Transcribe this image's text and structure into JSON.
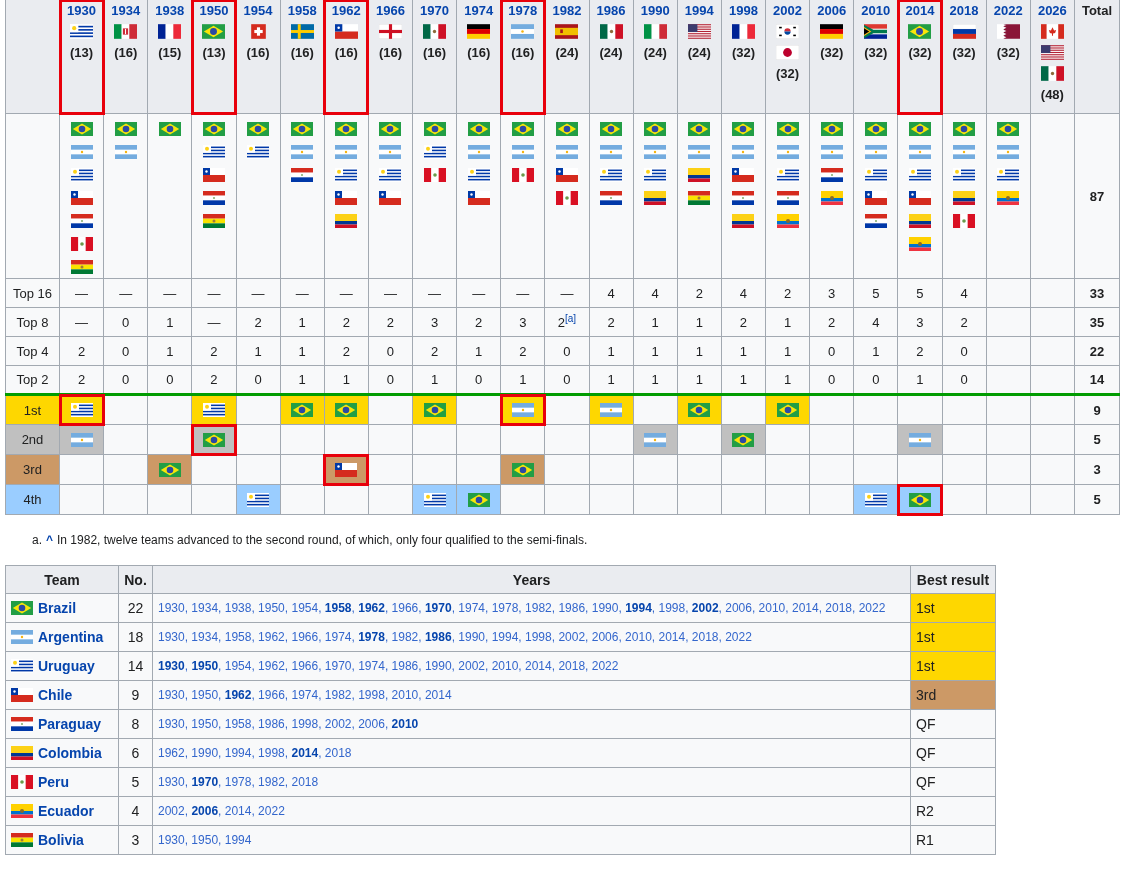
{
  "years": [
    {
      "year": "1930",
      "hosts": [
        {
          "kind": "URU"
        }
      ],
      "teams": "(13)",
      "highlighted": true,
      "qualified": [
        {
          "kind": "BRA"
        },
        {
          "kind": "ARG"
        },
        {
          "kind": "URU"
        },
        {
          "kind": "CHI"
        },
        {
          "kind": "PAR"
        },
        {
          "kind": "PER"
        },
        {
          "kind": "BOL"
        }
      ]
    },
    {
      "year": "1934",
      "hosts": [
        {
          "kind": "ITK"
        }
      ],
      "teams": "(16)",
      "highlighted": false,
      "qualified": [
        {
          "kind": "BRA"
        },
        {
          "kind": "ARG"
        }
      ]
    },
    {
      "year": "1938",
      "hosts": [
        {
          "kind": "FRA"
        }
      ],
      "teams": "(15)",
      "highlighted": false,
      "qualified": [
        {
          "kind": "BRA"
        }
      ]
    },
    {
      "year": "1950",
      "hosts": [
        {
          "kind": "BRA"
        }
      ],
      "teams": "(13)",
      "highlighted": true,
      "qualified": [
        {
          "kind": "BRA"
        },
        {
          "kind": "URU"
        },
        {
          "kind": "CHI"
        },
        {
          "kind": "PAR"
        },
        {
          "kind": "BOL"
        }
      ]
    },
    {
      "year": "1954",
      "hosts": [
        {
          "kind": "SUI"
        }
      ],
      "teams": "(16)",
      "highlighted": false,
      "qualified": [
        {
          "kind": "BRA"
        },
        {
          "kind": "URU"
        }
      ]
    },
    {
      "year": "1958",
      "hosts": [
        {
          "kind": "SWE"
        }
      ],
      "teams": "(16)",
      "highlighted": false,
      "qualified": [
        {
          "kind": "BRA"
        },
        {
          "kind": "ARG"
        },
        {
          "kind": "PAR"
        }
      ]
    },
    {
      "year": "1962",
      "hosts": [
        {
          "kind": "CHI"
        }
      ],
      "teams": "(16)",
      "highlighted": true,
      "qualified": [
        {
          "kind": "BRA"
        },
        {
          "kind": "ARG"
        },
        {
          "kind": "URU"
        },
        {
          "kind": "CHI"
        },
        {
          "kind": "COL"
        }
      ]
    },
    {
      "year": "1966",
      "hosts": [
        {
          "kind": "ENG"
        }
      ],
      "teams": "(16)",
      "highlighted": false,
      "qualified": [
        {
          "kind": "BRA"
        },
        {
          "kind": "ARG"
        },
        {
          "kind": "URU"
        },
        {
          "kind": "CHI"
        }
      ]
    },
    {
      "year": "1970",
      "hosts": [
        {
          "kind": "MEX"
        }
      ],
      "teams": "(16)",
      "highlighted": false,
      "qualified": [
        {
          "kind": "BRA"
        },
        {
          "kind": "URU"
        },
        {
          "kind": "PER"
        }
      ]
    },
    {
      "year": "1974",
      "hosts": [
        {
          "kind": "GER"
        }
      ],
      "teams": "(16)",
      "highlighted": false,
      "qualified": [
        {
          "kind": "BRA"
        },
        {
          "kind": "ARG"
        },
        {
          "kind": "URU"
        },
        {
          "kind": "CHI"
        }
      ]
    },
    {
      "year": "1978",
      "hosts": [
        {
          "kind": "ARG"
        }
      ],
      "teams": "(16)",
      "highlighted": true,
      "qualified": [
        {
          "kind": "BRA"
        },
        {
          "kind": "ARG"
        },
        {
          "kind": "PER"
        }
      ]
    },
    {
      "year": "1982",
      "hosts": [
        {
          "kind": "ESP"
        }
      ],
      "teams": "(24)",
      "highlighted": false,
      "qualified": [
        {
          "kind": "BRA"
        },
        {
          "kind": "ARG"
        },
        {
          "kind": "CHI"
        },
        {
          "kind": "PER"
        }
      ]
    },
    {
      "year": "1986",
      "hosts": [
        {
          "kind": "MEX"
        }
      ],
      "teams": "(24)",
      "highlighted": false,
      "qualified": [
        {
          "kind": "BRA"
        },
        {
          "kind": "ARG"
        },
        {
          "kind": "URU"
        },
        {
          "kind": "PAR"
        }
      ]
    },
    {
      "year": "1990",
      "hosts": [
        {
          "kind": "ITA"
        }
      ],
      "teams": "(24)",
      "highlighted": false,
      "qualified": [
        {
          "kind": "BRA"
        },
        {
          "kind": "ARG"
        },
        {
          "kind": "URU"
        },
        {
          "kind": "COL"
        }
      ]
    },
    {
      "year": "1994",
      "hosts": [
        {
          "kind": "USA"
        }
      ],
      "teams": "(24)",
      "highlighted": false,
      "qualified": [
        {
          "kind": "BRA"
        },
        {
          "kind": "ARG"
        },
        {
          "kind": "COL"
        },
        {
          "kind": "BOL"
        }
      ]
    },
    {
      "year": "1998",
      "hosts": [
        {
          "kind": "FRA"
        }
      ],
      "teams": "(32)",
      "highlighted": false,
      "qualified": [
        {
          "kind": "BRA"
        },
        {
          "kind": "ARG"
        },
        {
          "kind": "CHI"
        },
        {
          "kind": "PAR"
        },
        {
          "kind": "COL"
        }
      ]
    },
    {
      "year": "2002",
      "hosts": [
        {
          "kind": "KOR"
        },
        {
          "kind": "JPN"
        }
      ],
      "teams": "(32)",
      "highlighted": false,
      "qualified": [
        {
          "kind": "BRA"
        },
        {
          "kind": "ARG"
        },
        {
          "kind": "URU"
        },
        {
          "kind": "PAR"
        },
        {
          "kind": "ECU"
        }
      ]
    },
    {
      "year": "2006",
      "hosts": [
        {
          "kind": "GER"
        }
      ],
      "teams": "(32)",
      "highlighted": false,
      "qualified": [
        {
          "kind": "BRA"
        },
        {
          "kind": "ARG"
        },
        {
          "kind": "PAR"
        },
        {
          "kind": "ECU"
        }
      ]
    },
    {
      "year": "2010",
      "hosts": [
        {
          "kind": "RSA"
        }
      ],
      "teams": "(32)",
      "highlighted": false,
      "qualified": [
        {
          "kind": "BRA"
        },
        {
          "kind": "ARG"
        },
        {
          "kind": "URU"
        },
        {
          "kind": "CHI"
        },
        {
          "kind": "PAR"
        }
      ]
    },
    {
      "year": "2014",
      "hosts": [
        {
          "kind": "BRA"
        }
      ],
      "teams": "(32)",
      "highlighted": true,
      "qualified": [
        {
          "kind": "BRA"
        },
        {
          "kind": "ARG"
        },
        {
          "kind": "URU"
        },
        {
          "kind": "CHI"
        },
        {
          "kind": "COL"
        },
        {
          "kind": "ECU"
        }
      ]
    },
    {
      "year": "2018",
      "hosts": [
        {
          "kind": "RUS"
        }
      ],
      "teams": "(32)",
      "highlighted": false,
      "qualified": [
        {
          "kind": "BRA"
        },
        {
          "kind": "ARG"
        },
        {
          "kind": "URU"
        },
        {
          "kind": "COL"
        },
        {
          "kind": "PER"
        }
      ]
    },
    {
      "year": "2022",
      "hosts": [
        {
          "kind": "QAT"
        }
      ],
      "teams": "(32)",
      "highlighted": false,
      "qualified": [
        {
          "kind": "BRA"
        },
        {
          "kind": "ARG"
        },
        {
          "kind": "URU"
        },
        {
          "kind": "ECU"
        }
      ]
    },
    {
      "year": "2026",
      "hosts": [
        {
          "kind": "CAN"
        },
        {
          "kind": "USA"
        },
        {
          "kind": "MEX"
        }
      ],
      "teams": "(48)",
      "highlighted": false
    }
  ],
  "total_header": "Total",
  "qualified_total": "87",
  "stats": [
    {
      "label": "Top 16",
      "values": [
        "—",
        "—",
        "—",
        "—",
        "—",
        "—",
        "—",
        "—",
        "—",
        "—",
        "—",
        "—",
        "4",
        "4",
        "2",
        "4",
        "2",
        "3",
        "5",
        "5",
        "4"
      ],
      "total": "33"
    },
    {
      "label": "Top 8",
      "values": [
        "—",
        "0",
        "1",
        "—",
        "2",
        "1",
        "2",
        "2",
        "3",
        "2",
        "3",
        "2$^{[a]}$",
        "2",
        "1",
        "1",
        "2",
        "1",
        "2",
        "4",
        "3",
        "2"
      ],
      "total": "35"
    },
    {
      "label": "Top 4",
      "values": [
        "2",
        "0",
        "1",
        "2",
        "1",
        "1",
        "2",
        "0",
        "2",
        "1",
        "2",
        "0",
        "1",
        "1",
        "1",
        "1",
        "1",
        "0",
        "1",
        "2",
        "0"
      ],
      "total": "22"
    },
    {
      "label": "Top 2",
      "values": [
        "2",
        "0",
        "0",
        "2",
        "0",
        "1",
        "1",
        "0",
        "1",
        "0",
        "1",
        "0",
        "1",
        "1",
        "1",
        "1",
        "1",
        "0",
        "0",
        "1",
        "0"
      ],
      "total": "14"
    }
  ],
  "placements": [
    {
      "label": "1st",
      "color": "#fed700",
      "total": "9",
      "cells": [
        {
          "kind": "URU",
          "highlighted": true
        },
        {
          "kind": "none",
          "highlighted": false
        },
        {
          "kind": "none",
          "highlighted": false
        },
        {
          "kind": "URU",
          "highlighted": false
        },
        {
          "kind": "none",
          "highlighted": false
        },
        {
          "kind": "BRA",
          "highlighted": false
        },
        {
          "kind": "BRA",
          "highlighted": false
        },
        {
          "kind": "none",
          "highlighted": false
        },
        {
          "kind": "BRA",
          "highlighted": false
        },
        {
          "kind": "none",
          "highlighted": false
        },
        {
          "kind": "ARG",
          "highlighted": true
        },
        {
          "kind": "none",
          "highlighted": false
        },
        {
          "kind": "ARG",
          "highlighted": false
        },
        {
          "kind": "none",
          "highlighted": false
        },
        {
          "kind": "BRA",
          "highlighted": false
        },
        {
          "kind": "none",
          "highlighted": false
        },
        {
          "kind": "BRA",
          "highlighted": false
        },
        {
          "kind": "none",
          "highlighted": false
        },
        {
          "kind": "none",
          "highlighted": false
        },
        {
          "kind": "none",
          "highlighted": false
        },
        {
          "kind": "none",
          "highlighted": false
        },
        {
          "kind": "none",
          "highlighted": false
        },
        {
          "kind": "none",
          "highlighted": false
        }
      ]
    },
    {
      "label": "2nd",
      "color": "#c0c0c0",
      "total": "5",
      "cells": [
        {
          "kind": "ARG",
          "highlighted": false
        },
        {
          "kind": "none",
          "highlighted": false
        },
        {
          "kind": "none",
          "highlighted": false
        },
        {
          "kind": "BRA",
          "highlighted": true
        },
        {
          "kind": "none",
          "highlighted": false
        },
        {
          "kind": "none",
          "highlighted": false
        },
        {
          "kind": "none",
          "highlighted": false
        },
        {
          "kind": "none",
          "highlighted": false
        },
        {
          "kind": "none",
          "highlighted": false
        },
        {
          "kind": "none",
          "highlighted": false
        },
        {
          "kind": "none",
          "highlighted": false
        },
        {
          "kind": "none",
          "highlighted": false
        },
        {
          "kind": "none",
          "highlighted": false
        },
        {
          "kind": "ARG",
          "highlighted": false
        },
        {
          "kind": "none",
          "highlighted": false
        },
        {
          "kind": "BRA",
          "highlighted": false
        },
        {
          "kind": "none",
          "highlighted": false
        },
        {
          "kind": "none",
          "highlighted": false
        },
        {
          "kind": "none",
          "highlighted": false
        },
        {
          "kind": "ARG",
          "highlighted": false
        },
        {
          "kind": "none",
          "highlighted": false
        },
        {
          "kind": "none",
          "highlighted": false
        },
        {
          "kind": "none",
          "highlighted": false
        }
      ]
    },
    {
      "label": "3rd",
      "color": "#cc9966",
      "total": "3",
      "cells": [
        {
          "kind": "none",
          "highlighted": false
        },
        {
          "kind": "none",
          "highlighted": false
        },
        {
          "kind": "BRA",
          "highlighted": false
        },
        {
          "kind": "none",
          "highlighted": false
        },
        {
          "kind": "none",
          "highlighted": false
        },
        {
          "kind": "none",
          "highlighted": false
        },
        {
          "kind": "CHI",
          "highlighted": true
        },
        {
          "kind": "none",
          "highlighted": false
        },
        {
          "kind": "none",
          "highlighted": false
        },
        {
          "kind": "none",
          "highlighted": false
        },
        {
          "kind": "BRA",
          "highlighted": false
        },
        {
          "kind": "none",
          "highlighted": false
        },
        {
          "kind": "none",
          "highlighted": false
        },
        {
          "kind": "none",
          "highlighted": false
        },
        {
          "kind": "none",
          "highlighted": false
        },
        {
          "kind": "none",
          "highlighted": false
        },
        {
          "kind": "none",
          "highlighted": false
        },
        {
          "kind": "none",
          "highlighted": false
        },
        {
          "kind": "none",
          "highlighted": false
        },
        {
          "kind": "none",
          "highlighted": false
        },
        {
          "kind": "none",
          "highlighted": false
        },
        {
          "kind": "none",
          "highlighted": false
        },
        {
          "kind": "none",
          "highlighted": false
        }
      ]
    },
    {
      "label": "4th",
      "color": "#9acdff",
      "total": "5",
      "cells": [
        {
          "kind": "none",
          "highlighted": false
        },
        {
          "kind": "none",
          "highlighted": false
        },
        {
          "kind": "none",
          "highlighted": false
        },
        {
          "kind": "none",
          "highlighted": false
        },
        {
          "kind": "URU",
          "highlighted": false
        },
        {
          "kind": "none",
          "highlighted": false
        },
        {
          "kind": "none",
          "highlighted": false
        },
        {
          "kind": "none",
          "highlighted": false
        },
        {
          "kind": "URU",
          "highlighted": false
        },
        {
          "kind": "BRA",
          "highlighted": false
        },
        {
          "kind": "none",
          "highlighted": false
        },
        {
          "kind": "none",
          "highlighted": false
        },
        {
          "kind": "none",
          "highlighted": false
        },
        {
          "kind": "none",
          "highlighted": false
        },
        {
          "kind": "none",
          "highlighted": false
        },
        {
          "kind": "none",
          "highlighted": false
        },
        {
          "kind": "none",
          "highlighted": false
        },
        {
          "kind": "none",
          "highlighted": false
        },
        {
          "kind": "URU",
          "highlighted": false
        },
        {
          "kind": "BRA",
          "highlighted": true
        },
        {
          "kind": "none",
          "highlighted": false
        },
        {
          "kind": "none",
          "highlighted": false
        },
        {
          "kind": "none",
          "highlighted": false
        }
      ]
    }
  ],
  "footnote": {
    "marker": "a.",
    "link": "^",
    "text": "In 1982, twelve teams advanced to the second round, of which, only four qualified to the semi-finals."
  },
  "team_table": {
    "columns": [
      "Team",
      "No.",
      "Years",
      "Best result"
    ],
    "rows": [
      {
        "flag": {
          "kind": "BRA"
        },
        "team": "Brazil",
        "count": "22",
        "years": "1930, 1934, 1938, 1950, 1954, **1958**, **1962**, 1966, **1970**, 1974, 1978, 1982, 1986, 1990, **1994**, 1998, **2002**, 2006, 2010, 2014, 2018, 2022",
        "result": "1st",
        "color": "#fed700"
      },
      {
        "flag": {
          "kind": "ARG"
        },
        "team": "Argentina",
        "count": "18",
        "years": "1930, 1934, 1958, 1962, 1966, 1974, **1978**, 1982, **1986**, 1990, 1994, 1998, 2002, 2006, 2010, 2014, 2018, 2022",
        "result": "1st",
        "color": "#fed700"
      },
      {
        "flag": {
          "kind": "URU"
        },
        "team": "Uruguay",
        "count": "14",
        "years": "**1930**, **1950**, 1954, 1962, 1966, 1970, 1974, 1986, 1990, 2002, 2010, 2014, 2018, 2022",
        "result": "1st",
        "color": "#fed700"
      },
      {
        "flag": {
          "kind": "CHI"
        },
        "team": "Chile",
        "count": "9",
        "years": "1930, 1950, **1962**, 1966, 1974, 1982, 1998, 2010, 2014",
        "result": "3rd",
        "color": "#cc9966"
      },
      {
        "flag": {
          "kind": "PAR"
        },
        "team": "Paraguay",
        "count": "8",
        "years": "1930, 1950, 1958, 1986, 1998, 2002, 2006, **2010**",
        "result": "QF"
      },
      {
        "flag": {
          "kind": "COL"
        },
        "team": "Colombia",
        "count": "6",
        "years": "1962, 1990, 1994, 1998, **2014**, 2018",
        "result": "QF"
      },
      {
        "flag": {
          "kind": "PER"
        },
        "team": "Peru",
        "count": "5",
        "years": "1930, **1970**, 1978, 1982, 2018",
        "result": "QF"
      },
      {
        "flag": {
          "kind": "ECU"
        },
        "team": "Ecuador",
        "count": "4",
        "years": "2002, **2006**, 2014, 2022",
        "result": "R2"
      },
      {
        "flag": {
          "kind": "BOL"
        },
        "team": "Bolivia",
        "count": "3",
        "years": "1930, 1950, 1994",
        "result": "R1"
      }
    ]
  }
}
